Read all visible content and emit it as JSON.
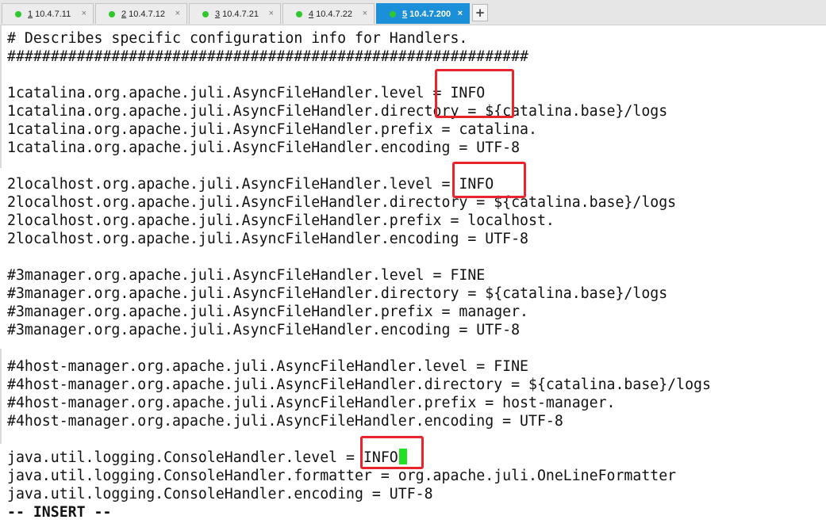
{
  "tabs": [
    {
      "num": "1",
      "label": "10.4.7.11",
      "active": false
    },
    {
      "num": "2",
      "label": "10.4.7.12",
      "active": false
    },
    {
      "num": "3",
      "label": "10.4.7.21",
      "active": false
    },
    {
      "num": "4",
      "label": "10.4.7.22",
      "active": false
    },
    {
      "num": "5",
      "label": "10.4.7.200",
      "active": true
    }
  ],
  "tab_close_glyph": "×",
  "new_tab_glyph": "+",
  "terminal": {
    "lines": [
      "# Describes specific configuration info for Handlers.",
      "############################################################",
      "",
      "1catalina.org.apache.juli.AsyncFileHandler.level = INFO",
      "1catalina.org.apache.juli.AsyncFileHandler.directory = ${catalina.base}/logs",
      "1catalina.org.apache.juli.AsyncFileHandler.prefix = catalina.",
      "1catalina.org.apache.juli.AsyncFileHandler.encoding = UTF-8",
      "",
      "2localhost.org.apache.juli.AsyncFileHandler.level = INFO",
      "2localhost.org.apache.juli.AsyncFileHandler.directory = ${catalina.base}/logs",
      "2localhost.org.apache.juli.AsyncFileHandler.prefix = localhost.",
      "2localhost.org.apache.juli.AsyncFileHandler.encoding = UTF-8",
      "",
      "#3manager.org.apache.juli.AsyncFileHandler.level = FINE",
      "#3manager.org.apache.juli.AsyncFileHandler.directory = ${catalina.base}/logs",
      "#3manager.org.apache.juli.AsyncFileHandler.prefix = manager.",
      "#3manager.org.apache.juli.AsyncFileHandler.encoding = UTF-8",
      "",
      "#4host-manager.org.apache.juli.AsyncFileHandler.level = FINE",
      "#4host-manager.org.apache.juli.AsyncFileHandler.directory = ${catalina.base}/logs",
      "#4host-manager.org.apache.juli.AsyncFileHandler.prefix = host-manager.",
      "#4host-manager.org.apache.juli.AsyncFileHandler.encoding = UTF-8",
      "",
      "java.util.logging.ConsoleHandler.level = INFO",
      "java.util.logging.ConsoleHandler.formatter = org.apache.juli.OneLineFormatter",
      "java.util.logging.ConsoleHandler.encoding = UTF-8"
    ],
    "status_line": "-- INSERT --"
  },
  "colors": {
    "active_tab": "#1b8fd8",
    "connected_dot": "#2fc82f",
    "highlight_box": "#e8242c",
    "cursor": "#22e022"
  }
}
